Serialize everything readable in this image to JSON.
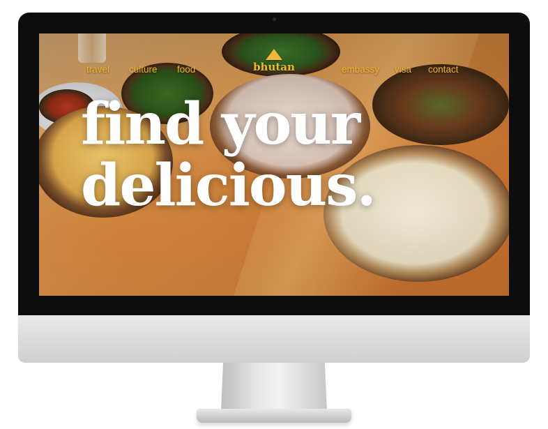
{
  "site": {
    "logo": {
      "text": "bhutan",
      "icon": "mountain-triangle-icon",
      "color": "#f2b62c"
    },
    "nav_left": [
      "travel",
      "culture",
      "food"
    ],
    "nav_right": [
      "embassy",
      "visa",
      "contact"
    ],
    "hero": {
      "line1": "find your",
      "line2": "delicious."
    }
  },
  "colors": {
    "accent": "#f2b62c",
    "headline": "#ffffff",
    "bezel": "#0d0d0d"
  }
}
